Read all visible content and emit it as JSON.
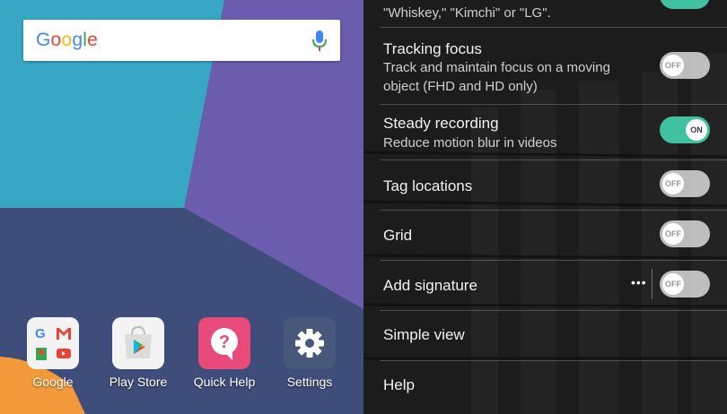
{
  "home": {
    "search": {
      "logo": "Google"
    },
    "apps": [
      {
        "label": "Google"
      },
      {
        "label": "Play Store"
      },
      {
        "label": "Quick Help"
      },
      {
        "label": "Settings"
      }
    ],
    "colors": {
      "accent_teal": "#39b0c7",
      "accent_purple": "#6a5aa8",
      "quick_help": "#e84a7a",
      "settings": "#47587a"
    }
  },
  "settings": {
    "partial_text": "\"Whiskey,\" \"Kimchi\" or \"LG\".",
    "items": [
      {
        "title": "Tracking focus",
        "subtitle_line1": "Track and maintain focus on a moving",
        "subtitle_line2": "object (FHD and HD only)",
        "toggle": "OFF"
      },
      {
        "title": "Steady recording",
        "subtitle_line1": "Reduce motion blur in videos",
        "toggle": "ON"
      },
      {
        "title": "Tag locations",
        "toggle": "OFF"
      },
      {
        "title": "Grid",
        "toggle": "OFF"
      },
      {
        "title": "Add signature",
        "more": "•••",
        "toggle": "OFF"
      },
      {
        "title": "Simple view"
      },
      {
        "title": "Help"
      }
    ],
    "colors": {
      "toggle_on": "#40c2a0",
      "toggle_off": "#e1e1e1"
    }
  }
}
